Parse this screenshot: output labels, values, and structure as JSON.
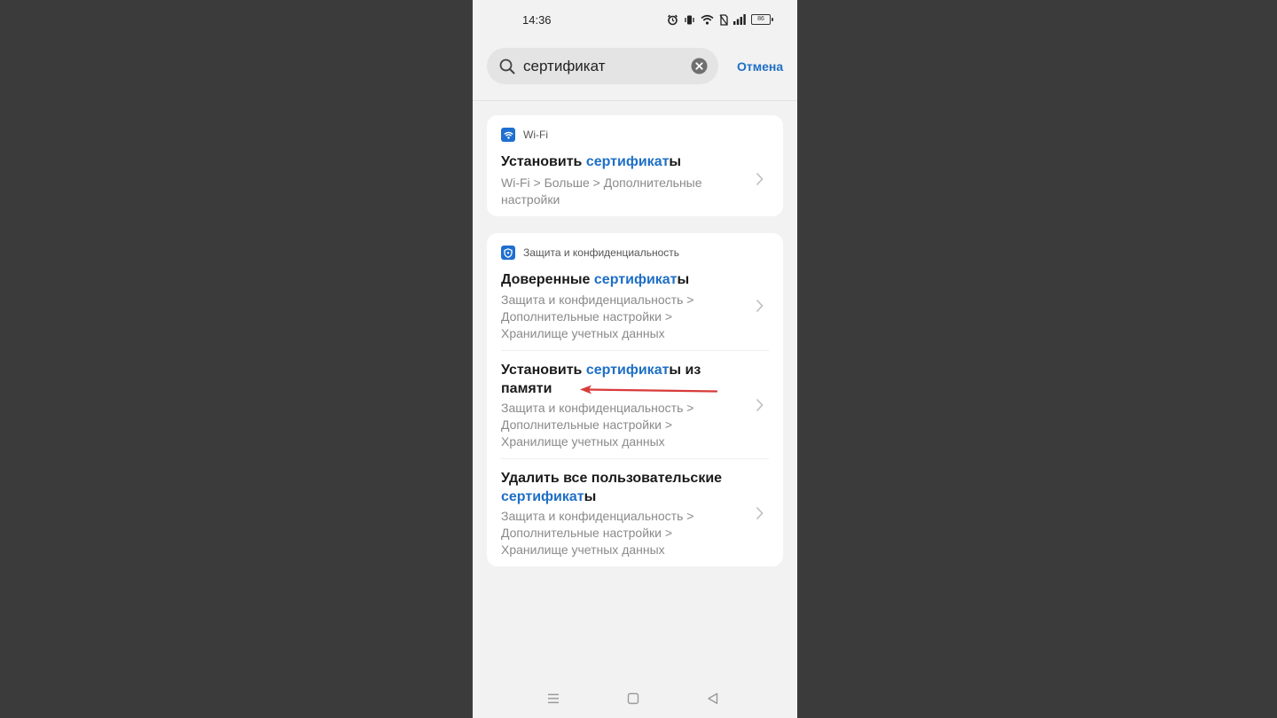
{
  "status_bar": {
    "time": "14:36",
    "battery": "86",
    "icons": [
      "alarm-icon",
      "vibrate-icon",
      "wifi-icon",
      "no-sim-icon",
      "signal-icon",
      "battery-icon"
    ]
  },
  "search": {
    "query": "сертификат",
    "cancel_label": "Отмена"
  },
  "highlight_color": "#1e6fc5",
  "sections": [
    {
      "label": "Wi-Fi",
      "icon": "wifi-icon",
      "items": [
        {
          "title_before": "Установить ",
          "title_match": "сертификат",
          "title_after": "ы",
          "path": "Wi-Fi > Больше > Дополнительные настройки"
        }
      ]
    },
    {
      "label": "Защита и конфиденциальность",
      "icon": "shield-icon",
      "items": [
        {
          "title_before": "Доверенные ",
          "title_match": "сертификат",
          "title_after": "ы",
          "path": "Защита и конфиденциальность > Дополнительные настройки > Хранилище учетных данных"
        },
        {
          "title_before": "Установить ",
          "title_match": "сертификат",
          "title_after": "ы из памяти",
          "path": "Защита и конфиденциальность > Дополнительные настройки > Хранилище учетных данных"
        },
        {
          "title_before": "Удалить все пользовательские ",
          "title_match": "сертификат",
          "title_after": "ы",
          "path": "Защита и конфиденциальность > Дополнительные настройки > Хранилище учетных данных"
        }
      ]
    }
  ],
  "annotation_color": "#d93a3a"
}
